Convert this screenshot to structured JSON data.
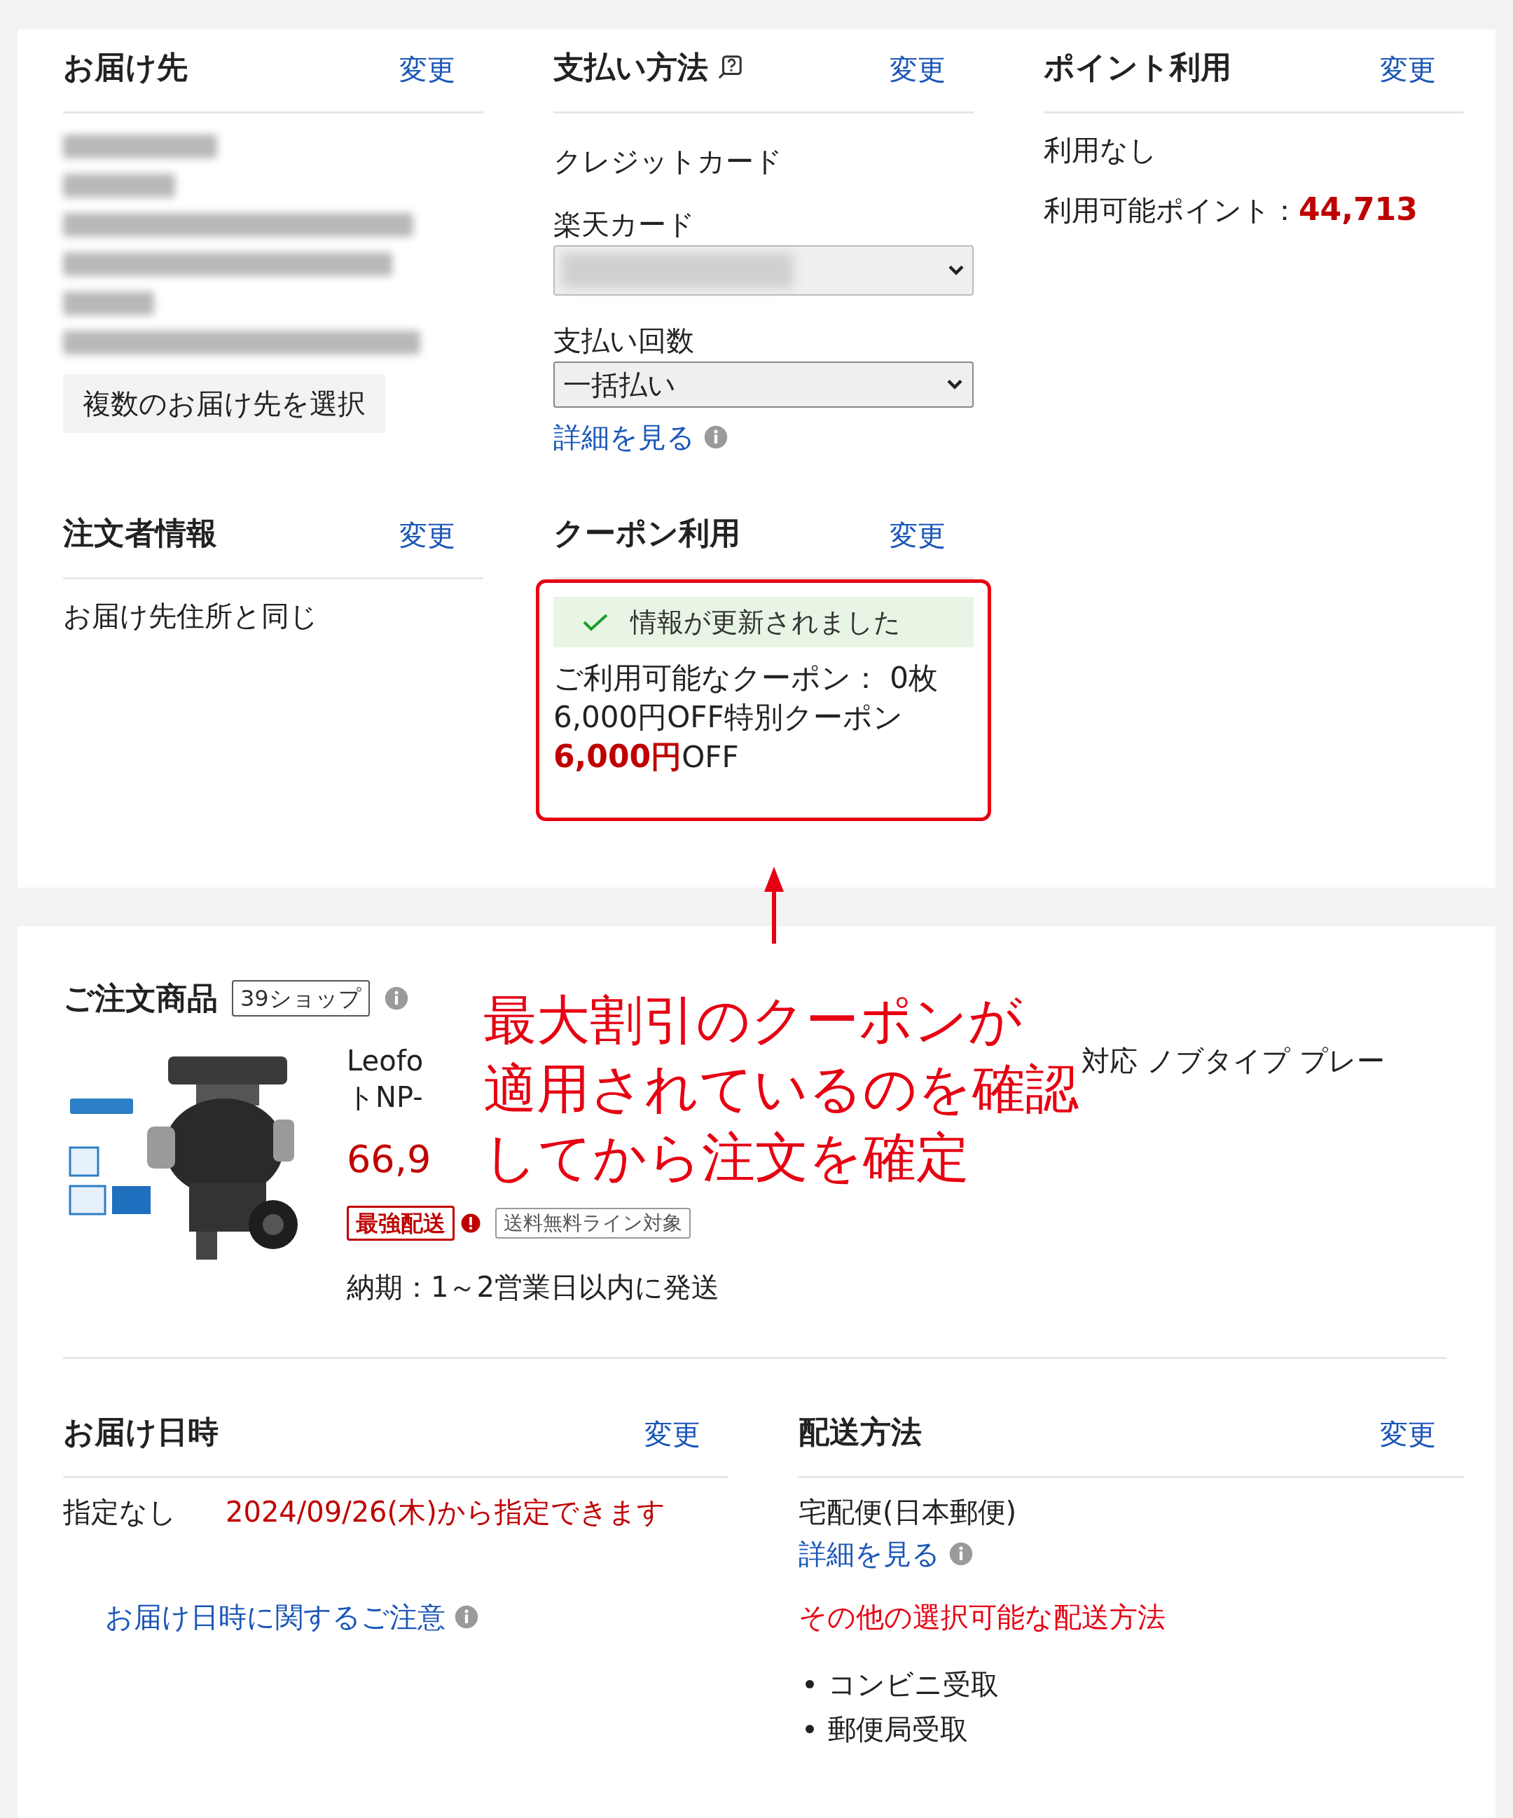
{
  "shipping_address": {
    "title": "お届け先",
    "change_link": "変更",
    "multi_button": "複数のお届け先を選択"
  },
  "payment": {
    "title": "支払い方法",
    "change_link": "変更",
    "method": "クレジットカード",
    "card_label": "楽天カード",
    "installments_label": "支払い回数",
    "installments_value": "一括払い",
    "details_link": "詳細を見る"
  },
  "points": {
    "title": "ポイント利用",
    "change_link": "変更",
    "usage": "利用なし",
    "available_label": "利用可能ポイント：",
    "available_value": "44,713"
  },
  "orderer": {
    "title": "注文者情報",
    "change_link": "変更",
    "info": "お届け先住所と同じ"
  },
  "coupon": {
    "title": "クーポン利用",
    "change_link": "変更",
    "notice": "情報が更新されました",
    "available": "ご利用可能なクーポン： 0枚",
    "coupon_name": "6,000円OFF特別クーポン",
    "discount_amount": "6,000円",
    "discount_suffix": "OFF"
  },
  "annotation": {
    "lines": [
      "最大割引のクーポンが",
      "適用されているのを確認",
      "してから注文を確定"
    ]
  },
  "order_items": {
    "title": "ご注文商品",
    "shop_count": "39ショップ",
    "item": {
      "title_start": "Leofo",
      "title_end": "対応 ノブタイプ プレー",
      "title_line2": "トNP-",
      "price": "66,9",
      "badges": [
        {
          "kind": "highlight",
          "label": "最強配送"
        },
        {
          "kind": "plain",
          "label": "送料無料ライン対象"
        }
      ],
      "delivery": "納期：1～2営業日以内に発送"
    }
  },
  "delivery_date": {
    "title": "お届け日時",
    "change_link": "変更",
    "value": "指定なし",
    "note": "2024/09/26(木)から指定できます",
    "caution_link": "お届け日時に関するご注意"
  },
  "shipping_method": {
    "title": "配送方法",
    "change_link": "変更",
    "method": "宅配便(日本郵便)",
    "details_link": "詳細を見る",
    "other_label": "その他の選択可能な配送方法",
    "options": [
      "コンビニ受取",
      "郵便局受取"
    ]
  }
}
